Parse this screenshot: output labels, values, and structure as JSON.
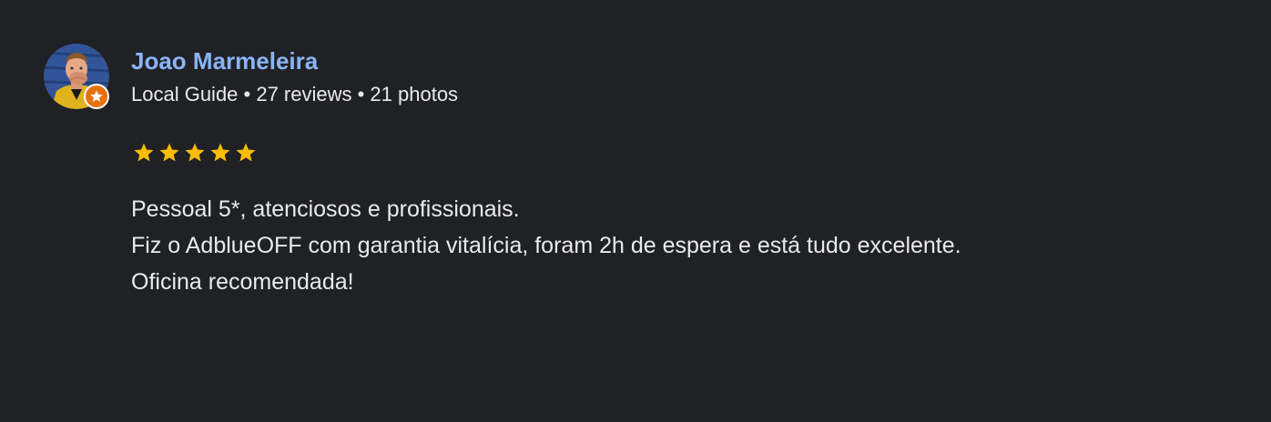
{
  "reviewer": {
    "name": "Joao Marmeleira",
    "meta": "Local Guide • 27 reviews • 21 photos",
    "avatar_icon": "person-avatar-icon",
    "badge_icon": "local-guide-star-icon"
  },
  "rating": {
    "stars": 5,
    "max": 5,
    "star_color": "#fbbc04"
  },
  "review": {
    "lines": [
      "Pessoal 5*, atenciosos e profissionais.",
      "Fiz o AdblueOFF com garantia vitalícia, foram 2h de espera e está tudo excelente.",
      "Oficina recomendada!"
    ]
  },
  "colors": {
    "background": "#202124",
    "name": "#8ab4f8",
    "text": "#e8eaed",
    "badge": "#e8710a"
  }
}
